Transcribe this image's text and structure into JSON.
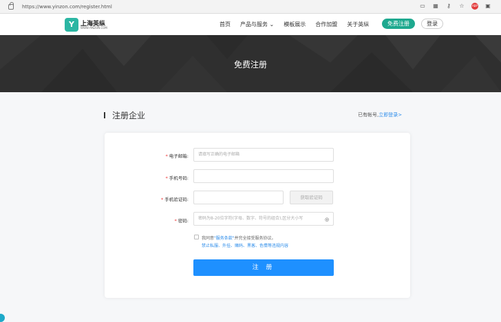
{
  "browser": {
    "url": "https://www.yinzon.com/register.html"
  },
  "header": {
    "logo_text": "上海英纵",
    "logo_sub": "WWW.YINZON.COM",
    "nav": [
      "首页",
      "产品与服务",
      "模板展示",
      "合作加盟",
      "关于英纵"
    ],
    "register_label": "免费注册",
    "login_label": "登录"
  },
  "banner": {
    "title": "免费注册"
  },
  "section": {
    "title": "注册企业",
    "have_account": "已有帐号,",
    "login_link": "立即登录>"
  },
  "form": {
    "email_label": "电子邮箱:",
    "email_placeholder": "请填写正确的电子邮箱",
    "phone_label": "手机号码:",
    "phone_placeholder": "",
    "code_label": "手机验证码:",
    "code_placeholder": "",
    "code_button": "获取验证码",
    "password_label": "密码:",
    "password_placeholder": "密码为8-20位字符(字母、数字、符号的组合),区分大小写",
    "agree_prefix": "我同意",
    "agree_link": "\"服务条款\"",
    "agree_suffix": "并完全接受服务协议。",
    "agree_note": "禁止私服、外挂、赌码、黑客、色情等违规内容",
    "submit_label": "注 册"
  },
  "colors": {
    "brand": "#1ea98f",
    "primary": "#1e90ff",
    "link": "#2a8bea",
    "banner_bg": "#2f2f2f"
  }
}
